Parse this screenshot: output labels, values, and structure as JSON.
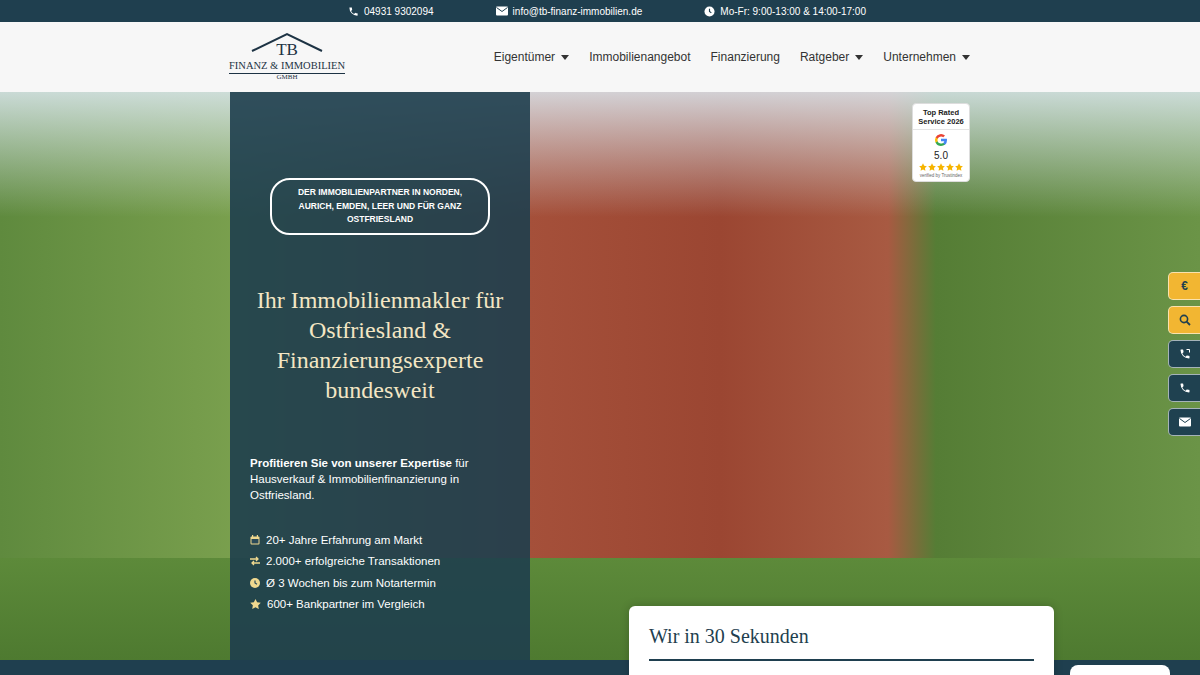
{
  "topbar": {
    "phone": "04931 9302094",
    "email": "info@tb-finanz-immobilien.de",
    "hours": "Mo-Fr: 9:00-13:00 & 14:00-17:00"
  },
  "logo": {
    "monogram": "TB",
    "name": "FINANZ & IMMOBILIEN",
    "suffix": "GMBH"
  },
  "nav": [
    {
      "label": "Eigentümer",
      "dropdown": true
    },
    {
      "label": "Immobilienangebot",
      "dropdown": false
    },
    {
      "label": "Finanzierung",
      "dropdown": false
    },
    {
      "label": "Ratgeber",
      "dropdown": true
    },
    {
      "label": "Unternehmen",
      "dropdown": true
    }
  ],
  "hero": {
    "badge": "DER IMMOBILIENPARTNER IN NORDEN, AURICH, EMDEN, LEER UND FÜR GANZ OSTFRIESLAND",
    "title": "Ihr Immobilienmakler für Ostfriesland & Finanzierungsexperte bundesweit",
    "intro_bold": "Profitieren Sie von unserer Expertise",
    "intro_rest": " für Hausverkauf & Immobilienfinanzierung in Ostfriesland.",
    "stats": [
      {
        "kind": "calendar",
        "text": "20+ Jahre Erfahrung am Markt"
      },
      {
        "kind": "transfer",
        "text": "2.000+ erfolgreiche Transaktionen"
      },
      {
        "kind": "clock",
        "text": "Ø 3 Wochen bis zum Notartermin"
      },
      {
        "kind": "star",
        "text": "600+ Bankpartner im Vergleich"
      }
    ]
  },
  "rating": {
    "title": "Top Rated Service 2026",
    "score": "5.0",
    "stars": 5,
    "verified": "verified by Trustindex"
  },
  "side_buttons": [
    {
      "kind": "euro",
      "label": "€",
      "color": "#f2b632"
    },
    {
      "kind": "search",
      "label": "",
      "color": "#f2b632"
    },
    {
      "kind": "callback",
      "label": "",
      "color": "#1f4150"
    },
    {
      "kind": "phone",
      "label": "",
      "color": "#1f4150"
    },
    {
      "kind": "mail",
      "label": "",
      "color": "#1f4150"
    }
  ],
  "video_card": {
    "title": "Wir in 30 Sekunden"
  }
}
